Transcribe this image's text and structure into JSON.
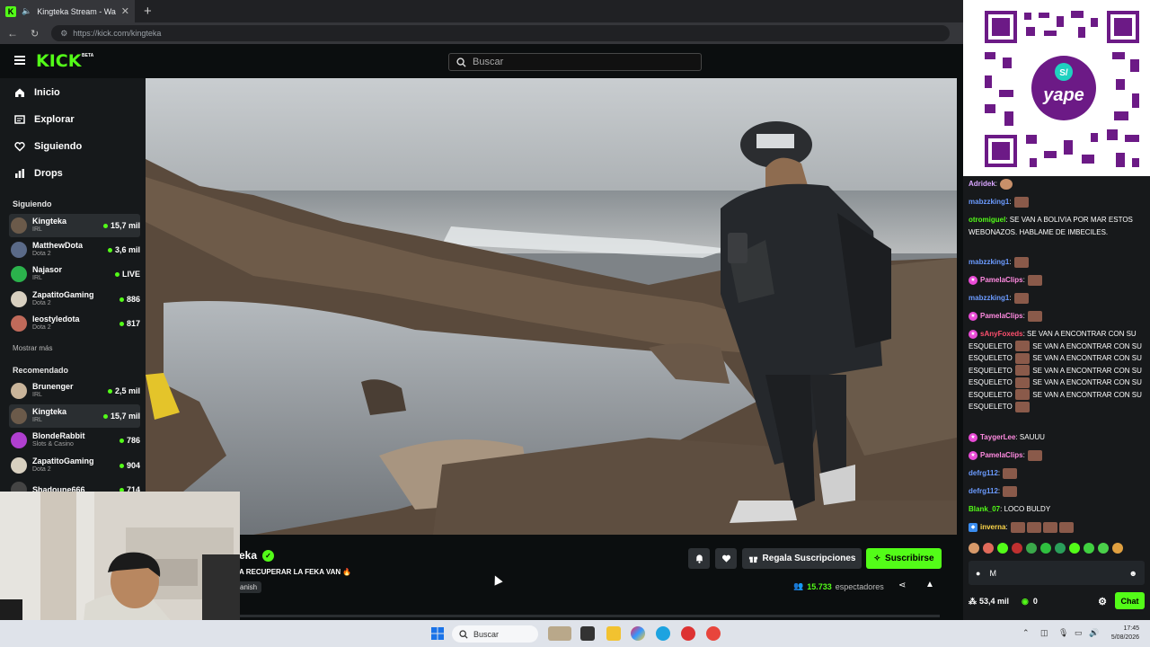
{
  "browser": {
    "tab_title": "Kingteka Stream - Watch Live",
    "tab_close": "✕",
    "new_tab": "+",
    "url": "https://kick.com/kingteka"
  },
  "header": {
    "logo": "KICK",
    "beta": "BETA",
    "search_placeholder": "Buscar"
  },
  "nav": [
    {
      "label": "Inicio",
      "icon": "home-icon"
    },
    {
      "label": "Explorar",
      "icon": "explore-icon"
    },
    {
      "label": "Siguiendo",
      "icon": "heart-icon"
    },
    {
      "label": "Drops",
      "icon": "drops-icon"
    }
  ],
  "following": {
    "title": "Siguiendo",
    "items": [
      {
        "name": "Kingteka",
        "category": "IRL",
        "viewers": "15,7 mil",
        "color": "#6b5a4a"
      },
      {
        "name": "MatthewDota",
        "category": "Dota 2",
        "viewers": "3,6 mil",
        "color": "#5a6a88"
      },
      {
        "name": "Najasor",
        "category": "IRL",
        "viewers": "LIVE",
        "color": "#2bb24c"
      },
      {
        "name": "ZapatitoGaming",
        "category": "Dota 2",
        "viewers": "886",
        "color": "#d8d0c0"
      },
      {
        "name": "leostyledota",
        "category": "Dota 2",
        "viewers": "817",
        "color": "#c06a5a"
      }
    ],
    "show_more": "Mostrar más"
  },
  "recommended": {
    "title": "Recomendado",
    "items": [
      {
        "name": "Brunenger",
        "category": "IRL",
        "viewers": "2,5 mil",
        "color": "#c9b49a"
      },
      {
        "name": "Kingteka",
        "category": "IRL",
        "viewers": "15,7 mil",
        "color": "#6b5a4a"
      },
      {
        "name": "BlondeRabbit",
        "category": "Slots & Casino",
        "viewers": "786",
        "color": "#b03fd0"
      },
      {
        "name": "ZapatitoGaming",
        "category": "Dota 2",
        "viewers": "904",
        "color": "#d8d0c0"
      },
      {
        "name": "Shadoune666",
        "category": "",
        "viewers": "714",
        "color": "#444"
      }
    ]
  },
  "stream": {
    "streamer": "eka",
    "title": "A RECUPERAR LA FEKA VAN 🔥",
    "tag": "anish",
    "gift_label": "Regala Suscripciones",
    "subscribe_label": "Suscribirse",
    "viewer_count": "15.733",
    "viewer_label": "espectadores"
  },
  "chat": {
    "messages": [
      {
        "user": "Adridek",
        "color": "#d9a6ff",
        "badge": "",
        "text": "",
        "emotes": 1,
        "face": true
      },
      {
        "user": "mabzzking1",
        "color": "#6b9bff",
        "badge": "",
        "text": "",
        "emotes": 1
      },
      {
        "user": "otromiguel",
        "color": "#53fc18",
        "badge": "",
        "text": "SE VAN A BOLIVIA POR MAR ESTOS WEBONAZOS. HABLAME DE IMBECILES.",
        "emotes": 0
      },
      {
        "user": "mabzzking1",
        "color": "#6b9bff",
        "badge": "",
        "text": "",
        "emotes": 1
      },
      {
        "user": "PamelaClips",
        "color": "#ff8ae0",
        "badge": "pink",
        "text": "",
        "emotes": 1
      },
      {
        "user": "mabzzking1",
        "color": "#6b9bff",
        "badge": "",
        "text": "",
        "emotes": 1
      },
      {
        "user": "PamelaClips",
        "color": "#ff8ae0",
        "badge": "pink",
        "text": "",
        "emotes": 1
      },
      {
        "user": "sAnyFoxeds",
        "color": "#ff4f6e",
        "badge": "pink",
        "text": "SE VAN A ENCONTRAR CON SU ESQUELETO",
        "spam": true
      },
      {
        "user": "TaygerLee",
        "color": "#ff8ae0",
        "badge": "pink",
        "text": "SAUUU",
        "emotes": 0
      },
      {
        "user": "PamelaClips",
        "color": "#ff8ae0",
        "badge": "pink",
        "text": "",
        "emotes": 1
      },
      {
        "user": "defrg112",
        "color": "#6b9bff",
        "badge": "",
        "text": "",
        "emotes": 1
      },
      {
        "user": "defrg112",
        "color": "#6b9bff",
        "badge": "",
        "text": "",
        "emotes": 1
      },
      {
        "user": "Blank_07",
        "color": "#53fc18",
        "badge": "",
        "text": "LOCO BULDY",
        "emotes": 0
      },
      {
        "user": "inverna",
        "color": "#ffd84a",
        "badge": "blue",
        "text": "",
        "emotes": 4
      }
    ],
    "input_value": "M",
    "followers": "53,4 mil",
    "points": "0",
    "chat_button": "Chat"
  },
  "taskbar": {
    "search_label": "Buscar",
    "time": "17:45",
    "date": "5/08/2026"
  }
}
